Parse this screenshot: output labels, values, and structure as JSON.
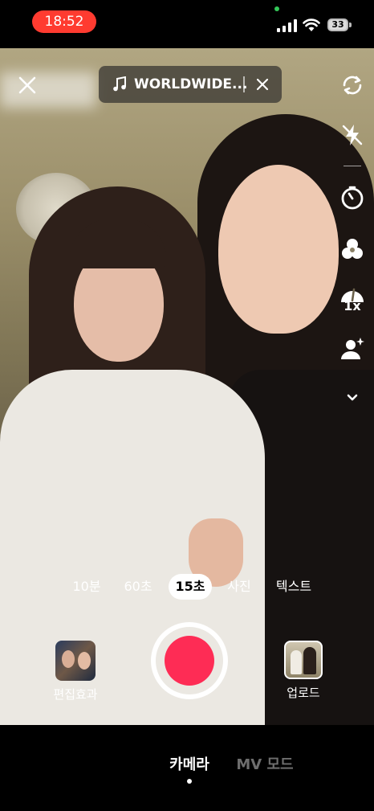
{
  "status_bar": {
    "time": "18:52",
    "battery": "33",
    "time_pill_color": "#ff3b30"
  },
  "top_bar": {
    "close_icon": "close-icon",
    "music": {
      "icon": "music-note-icon",
      "title": "WORLDWIDE...",
      "remove_icon": "close-icon"
    }
  },
  "side_toolbar": {
    "items": [
      {
        "icon": "flip-camera-icon"
      },
      {
        "icon": "flash-off-icon"
      },
      {
        "icon": "timer-icon"
      },
      {
        "icon": "filters-icon"
      },
      {
        "icon": "speed-icon",
        "label": "1x"
      },
      {
        "icon": "beauty-icon"
      },
      {
        "icon": "chevron-down-icon"
      }
    ]
  },
  "mode_selector": {
    "items": [
      "10분",
      "60초",
      "15초",
      "사진",
      "텍스트"
    ],
    "selected": "15초"
  },
  "controls": {
    "effects_label": "편집효과",
    "upload_label": "업로드",
    "record_color": "#fe2c55"
  },
  "bottom_tabs": {
    "camera": "카메라",
    "mv_mode": "MV 모드",
    "active": "카메라"
  }
}
